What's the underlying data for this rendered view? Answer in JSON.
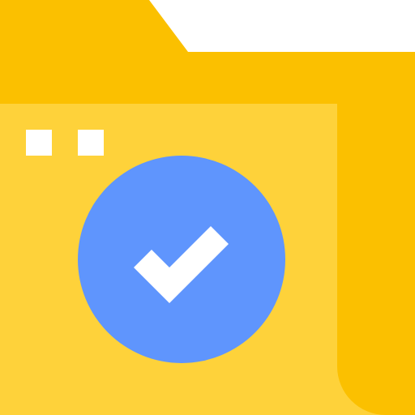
{
  "icon": {
    "name": "folder-check-icon",
    "colors": {
      "folder_back": "#fbc000",
      "folder_front": "#fed23a",
      "badge": "#5f95fd",
      "check": "#ffffff",
      "dots": "#ffffff",
      "background": "#ffffff"
    }
  }
}
